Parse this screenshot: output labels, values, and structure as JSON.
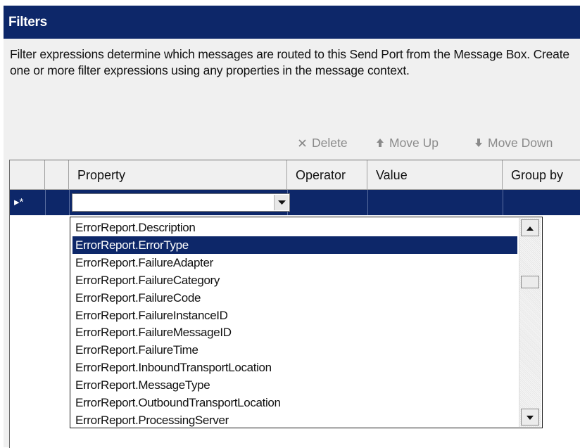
{
  "header": {
    "title": "Filters"
  },
  "description": "Filter expressions determine which messages are routed to this Send Port from the Message Box. Create one or more filter expressions using any properties in the message context.",
  "toolbar": {
    "delete_label": "Delete",
    "move_up_label": "Move Up",
    "move_down_label": "Move Down"
  },
  "grid": {
    "columns": [
      "Property",
      "Operator",
      "Value",
      "Group by"
    ],
    "new_row_indicator": "▸*",
    "property_value": ""
  },
  "dropdown": {
    "selected_index": 1,
    "options": [
      "ErrorReport.Description",
      "ErrorReport.ErrorType",
      "ErrorReport.FailureAdapter",
      "ErrorReport.FailureCategory",
      "ErrorReport.FailureCode",
      "ErrorReport.FailureInstanceID",
      "ErrorReport.FailureMessageID",
      "ErrorReport.FailureTime",
      "ErrorReport.InboundTransportLocation",
      "ErrorReport.MessageType",
      "ErrorReport.OutboundTransportLocation",
      "ErrorReport.ProcessingServer"
    ]
  },
  "colors": {
    "header_bg": "#0d2769",
    "selection_bg": "#0d2769",
    "panel_bg": "#f0f0f0",
    "disabled_text": "#8a8a8a"
  },
  "icons": {
    "delete": "x-icon",
    "move_up": "arrow-up-icon",
    "move_down": "arrow-down-icon",
    "combo": "chevron-down-icon"
  }
}
